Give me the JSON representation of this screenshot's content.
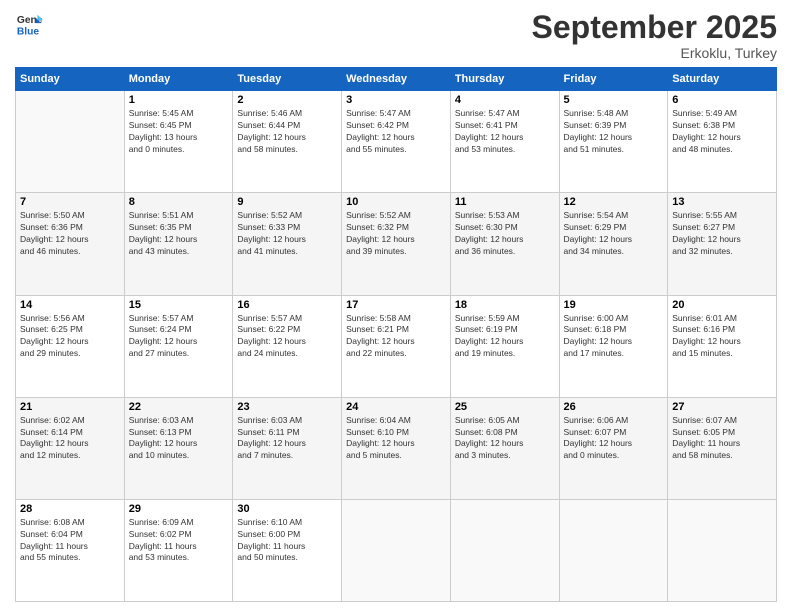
{
  "logo": {
    "line1": "General",
    "line2": "Blue"
  },
  "title": "September 2025",
  "subtitle": "Erkoklu, Turkey",
  "days_of_week": [
    "Sunday",
    "Monday",
    "Tuesday",
    "Wednesday",
    "Thursday",
    "Friday",
    "Saturday"
  ],
  "weeks": [
    [
      {
        "day": "",
        "info": ""
      },
      {
        "day": "1",
        "info": "Sunrise: 5:45 AM\nSunset: 6:45 PM\nDaylight: 13 hours\nand 0 minutes."
      },
      {
        "day": "2",
        "info": "Sunrise: 5:46 AM\nSunset: 6:44 PM\nDaylight: 12 hours\nand 58 minutes."
      },
      {
        "day": "3",
        "info": "Sunrise: 5:47 AM\nSunset: 6:42 PM\nDaylight: 12 hours\nand 55 minutes."
      },
      {
        "day": "4",
        "info": "Sunrise: 5:47 AM\nSunset: 6:41 PM\nDaylight: 12 hours\nand 53 minutes."
      },
      {
        "day": "5",
        "info": "Sunrise: 5:48 AM\nSunset: 6:39 PM\nDaylight: 12 hours\nand 51 minutes."
      },
      {
        "day": "6",
        "info": "Sunrise: 5:49 AM\nSunset: 6:38 PM\nDaylight: 12 hours\nand 48 minutes."
      }
    ],
    [
      {
        "day": "7",
        "info": "Sunrise: 5:50 AM\nSunset: 6:36 PM\nDaylight: 12 hours\nand 46 minutes."
      },
      {
        "day": "8",
        "info": "Sunrise: 5:51 AM\nSunset: 6:35 PM\nDaylight: 12 hours\nand 43 minutes."
      },
      {
        "day": "9",
        "info": "Sunrise: 5:52 AM\nSunset: 6:33 PM\nDaylight: 12 hours\nand 41 minutes."
      },
      {
        "day": "10",
        "info": "Sunrise: 5:52 AM\nSunset: 6:32 PM\nDaylight: 12 hours\nand 39 minutes."
      },
      {
        "day": "11",
        "info": "Sunrise: 5:53 AM\nSunset: 6:30 PM\nDaylight: 12 hours\nand 36 minutes."
      },
      {
        "day": "12",
        "info": "Sunrise: 5:54 AM\nSunset: 6:29 PM\nDaylight: 12 hours\nand 34 minutes."
      },
      {
        "day": "13",
        "info": "Sunrise: 5:55 AM\nSunset: 6:27 PM\nDaylight: 12 hours\nand 32 minutes."
      }
    ],
    [
      {
        "day": "14",
        "info": "Sunrise: 5:56 AM\nSunset: 6:25 PM\nDaylight: 12 hours\nand 29 minutes."
      },
      {
        "day": "15",
        "info": "Sunrise: 5:57 AM\nSunset: 6:24 PM\nDaylight: 12 hours\nand 27 minutes."
      },
      {
        "day": "16",
        "info": "Sunrise: 5:57 AM\nSunset: 6:22 PM\nDaylight: 12 hours\nand 24 minutes."
      },
      {
        "day": "17",
        "info": "Sunrise: 5:58 AM\nSunset: 6:21 PM\nDaylight: 12 hours\nand 22 minutes."
      },
      {
        "day": "18",
        "info": "Sunrise: 5:59 AM\nSunset: 6:19 PM\nDaylight: 12 hours\nand 19 minutes."
      },
      {
        "day": "19",
        "info": "Sunrise: 6:00 AM\nSunset: 6:18 PM\nDaylight: 12 hours\nand 17 minutes."
      },
      {
        "day": "20",
        "info": "Sunrise: 6:01 AM\nSunset: 6:16 PM\nDaylight: 12 hours\nand 15 minutes."
      }
    ],
    [
      {
        "day": "21",
        "info": "Sunrise: 6:02 AM\nSunset: 6:14 PM\nDaylight: 12 hours\nand 12 minutes."
      },
      {
        "day": "22",
        "info": "Sunrise: 6:03 AM\nSunset: 6:13 PM\nDaylight: 12 hours\nand 10 minutes."
      },
      {
        "day": "23",
        "info": "Sunrise: 6:03 AM\nSunset: 6:11 PM\nDaylight: 12 hours\nand 7 minutes."
      },
      {
        "day": "24",
        "info": "Sunrise: 6:04 AM\nSunset: 6:10 PM\nDaylight: 12 hours\nand 5 minutes."
      },
      {
        "day": "25",
        "info": "Sunrise: 6:05 AM\nSunset: 6:08 PM\nDaylight: 12 hours\nand 3 minutes."
      },
      {
        "day": "26",
        "info": "Sunrise: 6:06 AM\nSunset: 6:07 PM\nDaylight: 12 hours\nand 0 minutes."
      },
      {
        "day": "27",
        "info": "Sunrise: 6:07 AM\nSunset: 6:05 PM\nDaylight: 11 hours\nand 58 minutes."
      }
    ],
    [
      {
        "day": "28",
        "info": "Sunrise: 6:08 AM\nSunset: 6:04 PM\nDaylight: 11 hours\nand 55 minutes."
      },
      {
        "day": "29",
        "info": "Sunrise: 6:09 AM\nSunset: 6:02 PM\nDaylight: 11 hours\nand 53 minutes."
      },
      {
        "day": "30",
        "info": "Sunrise: 6:10 AM\nSunset: 6:00 PM\nDaylight: 11 hours\nand 50 minutes."
      },
      {
        "day": "",
        "info": ""
      },
      {
        "day": "",
        "info": ""
      },
      {
        "day": "",
        "info": ""
      },
      {
        "day": "",
        "info": ""
      }
    ]
  ]
}
